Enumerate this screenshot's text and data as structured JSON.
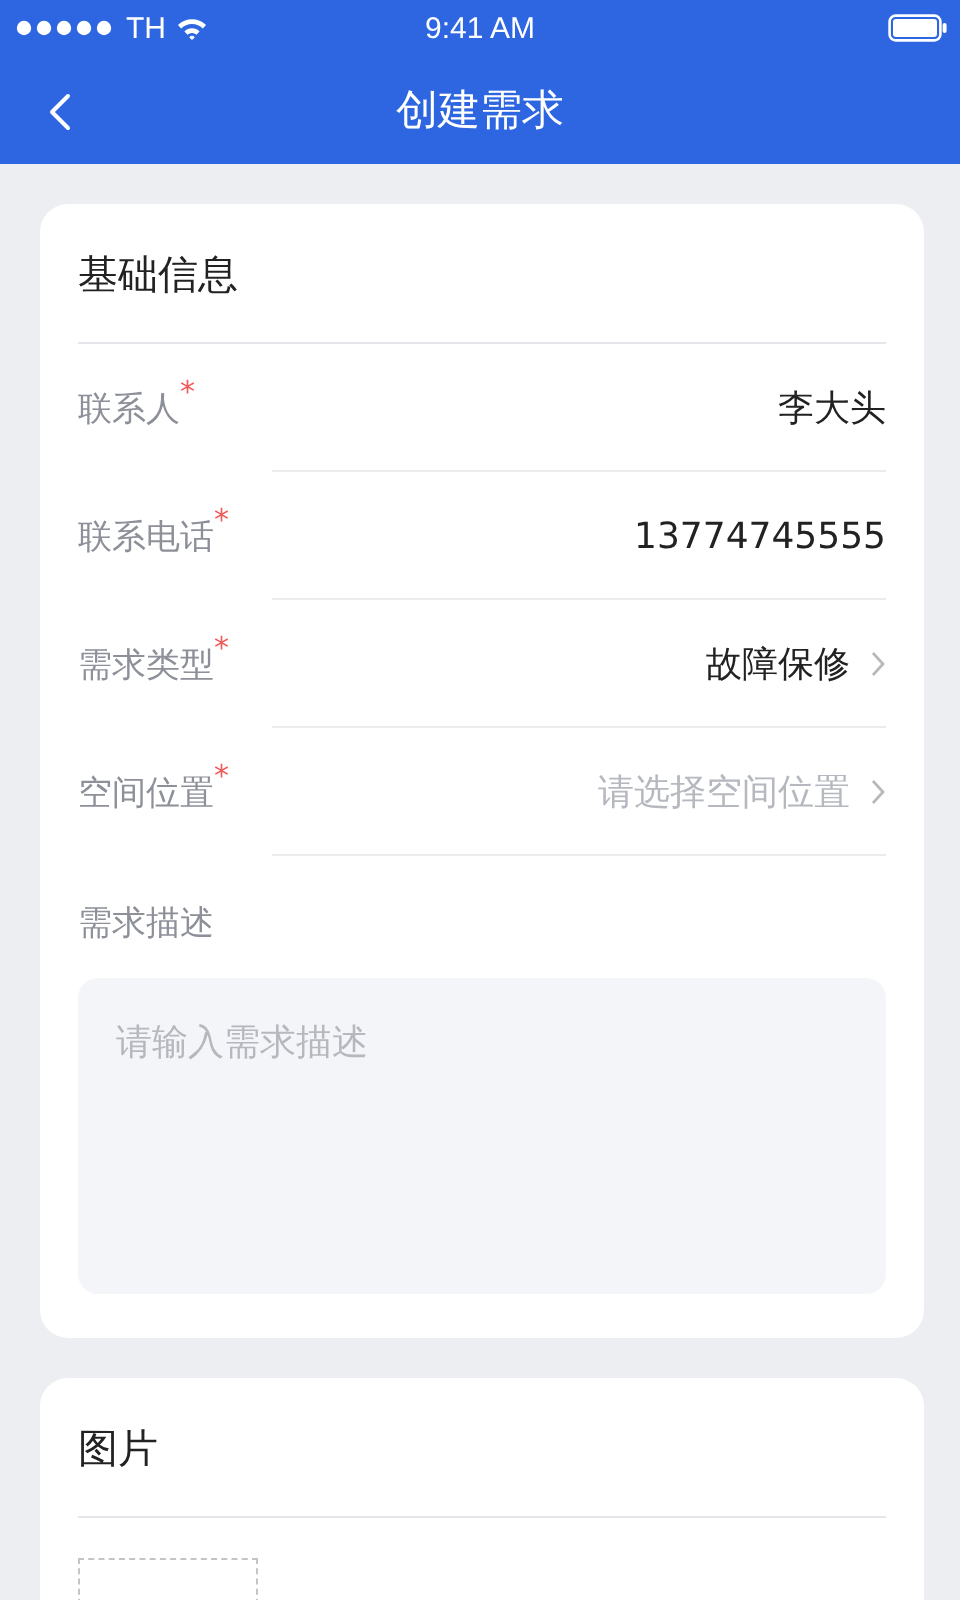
{
  "status_bar": {
    "carrier": "TH",
    "time": "9:41 AM"
  },
  "nav": {
    "title": "创建需求"
  },
  "basic": {
    "title": "基础信息",
    "fields": [
      {
        "label": "联系人",
        "required_mark": "*",
        "kind": "text",
        "value": "李大头"
      },
      {
        "label": "联系电话",
        "required_mark": "*",
        "kind": "text",
        "value": "13774745555"
      },
      {
        "label": "需求类型",
        "required_mark": "*",
        "kind": "select",
        "value": "故障保修"
      },
      {
        "label": "空间位置",
        "required_mark": "*",
        "kind": "select",
        "placeholder": "请选择空间位置"
      }
    ],
    "description": {
      "label": "需求描述",
      "placeholder": "请输入需求描述"
    }
  },
  "images": {
    "title": "图片"
  }
}
